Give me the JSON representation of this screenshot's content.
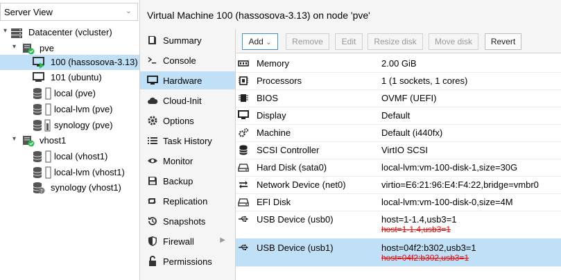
{
  "left": {
    "view_selector": "Server View",
    "tree": [
      {
        "label": "Datacenter (vcluster)",
        "icon": "datacenter-icon",
        "selected": false,
        "expanded": true
      },
      {
        "label": "pve",
        "icon": "node-online-icon",
        "selected": false,
        "expanded": true
      },
      {
        "label": "100 (hassosova-3.13)",
        "icon": "vm-running-icon",
        "selected": true
      },
      {
        "label": "101 (ubuntu)",
        "icon": "vm-stopped-icon",
        "selected": false
      },
      {
        "label": "local (pve)",
        "icon": "storage-icon",
        "selected": false
      },
      {
        "label": "local-lvm (pve)",
        "icon": "storage-icon",
        "selected": false
      },
      {
        "label": "synology (pve)",
        "icon": "storage-icon",
        "selected": false
      },
      {
        "label": "vhost1",
        "icon": "node-online-icon",
        "selected": false,
        "expanded": true
      },
      {
        "label": "local (vhost1)",
        "icon": "storage-icon",
        "selected": false
      },
      {
        "label": "local-lvm (vhost1)",
        "icon": "storage-icon",
        "selected": false
      },
      {
        "label": "synology (vhost1)",
        "icon": "storage-unknown-icon",
        "selected": false
      }
    ]
  },
  "header": {
    "title": "Virtual Machine 100 (hassosova-3.13) on node 'pve'"
  },
  "tabs": [
    {
      "label": "Summary",
      "icon": "book-icon"
    },
    {
      "label": "Console",
      "icon": "terminal-icon"
    },
    {
      "label": "Hardware",
      "icon": "monitor-icon",
      "selected": true
    },
    {
      "label": "Cloud-Init",
      "icon": "cloud-icon"
    },
    {
      "label": "Options",
      "icon": "gear-icon"
    },
    {
      "label": "Task History",
      "icon": "list-icon"
    },
    {
      "label": "Monitor",
      "icon": "eye-icon"
    },
    {
      "label": "Backup",
      "icon": "floppy-icon"
    },
    {
      "label": "Replication",
      "icon": "retweet-icon"
    },
    {
      "label": "Snapshots",
      "icon": "history-icon"
    },
    {
      "label": "Firewall",
      "icon": "shield-icon",
      "has_submenu": true
    },
    {
      "label": "Permissions",
      "icon": "unlock-icon"
    }
  ],
  "toolbar": {
    "add": "Add",
    "remove": "Remove",
    "edit": "Edit",
    "resize": "Resize disk",
    "move": "Move disk",
    "revert": "Revert"
  },
  "hardware": [
    {
      "key": "Memory",
      "value": "2.00 GiB",
      "icon": "memory-icon"
    },
    {
      "key": "Processors",
      "value": "1 (1 sockets, 1 cores)",
      "icon": "cpu-icon"
    },
    {
      "key": "BIOS",
      "value": "OVMF (UEFI)",
      "icon": "microchip-icon"
    },
    {
      "key": "Display",
      "value": "Default",
      "icon": "display-icon"
    },
    {
      "key": "Machine",
      "value": "Default (i440fx)",
      "icon": "cogs-icon"
    },
    {
      "key": "SCSI Controller",
      "value": "VirtIO SCSI",
      "icon": "database-icon"
    },
    {
      "key": "Hard Disk (sata0)",
      "value": "local-lvm:vm-100-disk-1,size=30G",
      "icon": "hdd-icon"
    },
    {
      "key": "Network Device (net0)",
      "value": "virtio=E6:21:96:E4:F4:22,bridge=vmbr0",
      "icon": "exchange-icon"
    },
    {
      "key": "EFI Disk",
      "value": "local-lvm:vm-100-disk-0,size=4M",
      "icon": "hdd-icon"
    },
    {
      "key": "USB Device (usb0)",
      "value": "host=1-1.4,usb3=1",
      "pending_removed": "host=1-1.4,usb3=1",
      "icon": "usb-icon"
    },
    {
      "key": "USB Device (usb1)",
      "value": "host=04f2:b302,usb3=1",
      "pending_removed": "host=04f2:b302,usb3=1",
      "icon": "usb-icon",
      "selected": true
    }
  ]
}
